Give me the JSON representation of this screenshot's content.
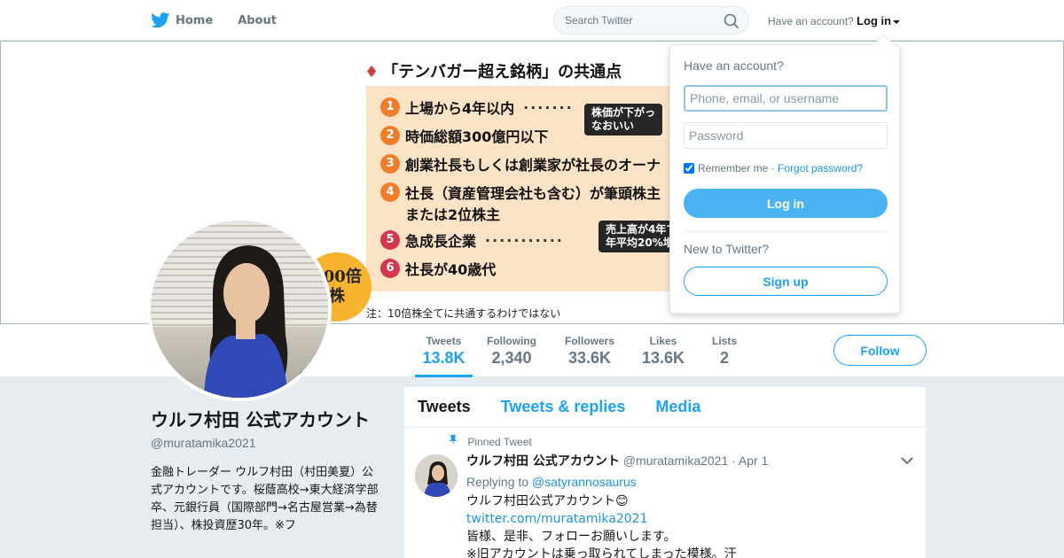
{
  "nav": {
    "home_label": "Home",
    "about_label": "About",
    "search_placeholder": "Search Twitter",
    "account_prompt": "Have an account?",
    "login_label": "Log in"
  },
  "banner": {
    "title": "「テンバガー超え銘柄」の共通点",
    "items": [
      {
        "num": "1",
        "text": "上場から4年以内"
      },
      {
        "num": "2",
        "text": "時価総額300億円以下"
      },
      {
        "num": "3",
        "text": "創業社長もしくは創業家が社長のオーナ"
      },
      {
        "num": "4",
        "text": "社長（資産管理会社も含む）が筆頭株主"
      },
      {
        "num": "",
        "text": "または2位株主"
      },
      {
        "num": "5",
        "text": "急成長企業"
      },
      {
        "num": "6",
        "text": "社長が40歳代"
      }
    ],
    "bubble1_line1": "株価が下がっ",
    "bubble1_line2": "なおいい",
    "bubble2_line1": "売上高が4年で",
    "bubble2_line2": "年平均20%増",
    "badge_line1": "100倍",
    "badge_line2": "株",
    "note": "注：10倍株全てに共通するわけではない"
  },
  "stats": [
    {
      "label": "Tweets",
      "value": "13.8K"
    },
    {
      "label": "Following",
      "value": "2,340"
    },
    {
      "label": "Followers",
      "value": "33.6K"
    },
    {
      "label": "Likes",
      "value": "13.6K"
    },
    {
      "label": "Lists",
      "value": "2"
    }
  ],
  "follow_label": "Follow",
  "profile": {
    "name": "ウルフ村田 公式アカウント",
    "handle": "@muratamika2021",
    "bio": "金融トレーダー ウルフ村田（村田美夏）公式アカウントです。桜蔭高校→東大経済学部卒、元銀行員（国際部門→名古屋営業→為替担当）、株投資歴30年。※フ"
  },
  "timeline": {
    "tabs": [
      "Tweets",
      "Tweets & replies",
      "Media"
    ],
    "tweet": {
      "pinned_label": "Pinned Tweet",
      "name": "ウルフ村田 公式アカウント",
      "handle": "@muratamika2021",
      "date": "· Apr 1",
      "replying_prefix": "Replying to",
      "replying_to": "@satyrannosaurus",
      "line1": "ウルフ村田公式アカウント😊",
      "link": "twitter.com/muratamika2021",
      "line2": "皆様、是非、フォローお願いします。",
      "line3": "※旧アカウントは乗っ取られてしまった模様。汗"
    }
  },
  "login_dropdown": {
    "title": "Have an account?",
    "username_placeholder": "Phone, email, or username",
    "password_placeholder": "Password",
    "remember_label": "Remember me",
    "separator": " · ",
    "forgot_label": "Forgot password?",
    "login_button": "Log in",
    "new_prompt": "New to Twitter?",
    "signup_button": "Sign up"
  },
  "colors": {
    "accent": "#1da1f2",
    "login_button": "#4ab3f4",
    "background": "#e6ecf0"
  }
}
